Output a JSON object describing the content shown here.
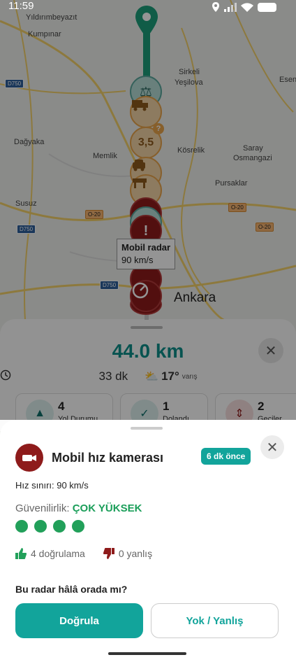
{
  "status_bar": {
    "time": "11:59"
  },
  "map": {
    "places": [
      "Yıldırımbeyazıt",
      "Kumpınar",
      "Sirkeli",
      "Yeşilova",
      "Dağyaka",
      "Memlik",
      "Kösrelik",
      "Saray",
      "Osmangazi",
      "Pursaklar",
      "Susuz",
      "Ankara"
    ],
    "edge_label": "Esen",
    "roads": {
      "d750": "D750",
      "o20": "O-20"
    },
    "hazard_3_5": "3,5",
    "hazard_badge": "?",
    "tooltip": {
      "title": "Mobil radar",
      "speed": "90 km/s"
    }
  },
  "route_panel": {
    "distance": "44.0 km",
    "duration": "33 dk",
    "temperature": "17°",
    "arrival": "varış",
    "close": "✕",
    "cards": [
      {
        "count": "4",
        "label": "Yol Durumu"
      },
      {
        "count": "1",
        "label": "Dolandı"
      },
      {
        "count": "2",
        "label": "Geciler"
      }
    ]
  },
  "radar_sheet": {
    "title": "Mobil hız kamerası",
    "time_ago": "6 dk önce",
    "close": "✕",
    "speed_limit": "Hız sınırı: 90 km/s",
    "reliability_label": "Güvenilirlik:",
    "reliability_value": "ÇOK YÜKSEK",
    "reliability_dots": 4,
    "confirmations": "4 doğrulama",
    "wrongs": "0 yanlış",
    "question": "Bu radar hâlâ orada mı?",
    "confirm_button": "Doğrula",
    "reject_button": "Yok / Yanlış"
  },
  "colors": {
    "accent": "#12a49b",
    "danger": "#8e1b1b",
    "success": "#22a05a"
  },
  "icons": [
    "location-icon",
    "signal-icon",
    "wifi-icon",
    "battery-icon",
    "scale-icon",
    "truck-icon",
    "car-icon",
    "road-work-icon",
    "warning-icon",
    "speedometer-icon",
    "camera-icon",
    "thumbs-up-icon",
    "thumbs-down-icon",
    "clock-icon",
    "weather-icon"
  ]
}
